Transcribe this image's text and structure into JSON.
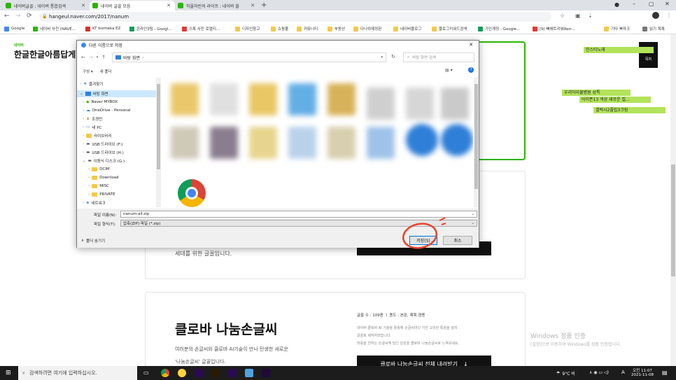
{
  "browser": {
    "tabs": [
      {
        "label": "네이버글꼴 : 네이버 통합검색"
      },
      {
        "label": "네이버 글꼴 모음"
      },
      {
        "label": "하울하린의 라이프 : 네이버 블"
      }
    ],
    "url": "hangeul.naver.com/2017/nanum",
    "bookmarks": [
      "Google",
      "네이버 사전 (NAVE...",
      "KT bizmeka EZ",
      "온라인3팀 - Googl...",
      "스톡 사진 로열티...",
      "디자인참고",
      "쇼핑몰",
      "커뮤니티",
      "부동산",
      "다나와제정된",
      "네이버블로그",
      "블로그키워드검색",
      "가인계정 - Google...",
      "(9) 뼤에트리뷰Rerr...",
      "기타 북마크",
      "읽기 목록"
    ]
  },
  "site": {
    "logo_small": "네이버",
    "logo_main": "한글한글아름답게",
    "menu_label": "목차",
    "card2_desc": "세대를 위한 글꼴입니다.",
    "card3": {
      "title": "클로바 나눔손글씨",
      "desc_line1": "여러분의 손글씨와 클로바 AI기술이 만나 탄생한 새로운",
      "desc_line2": "'나눔손글씨' 글꼴입니다.",
      "meta": "글꼴 수 : 109종 ㅣ 용도 : 본문, 제목 겸용",
      "info_line1": "네이버 클로바 AI 기술을 활용해 손글씨마다 가진 고유한 특징을 살려",
      "info_line2": "글꼴로 제작하였습니다.",
      "info_line3": "마음을 전하는 손글씨에 담긴 감성을 클로바 나눔손글씨로 느껴보세요.",
      "download_label": "클로바 나눔손글씨 전체 내려받기"
    },
    "sticky_notes": [
      "인스타노래",
      "우리아이물병원 성특",
      "아이폰13 색상 새로운 컬...",
      "갤럭시2플립3크림"
    ],
    "watermark_line1": "Windows 정품 인증",
    "watermark_line2": "[설정]으로 이동하여 Windows를 정품 인증합니다."
  },
  "dialog": {
    "title": "다른 이름으로 저장",
    "path": "바탕 화면",
    "search_placeholder": "바탕 화면 검색",
    "organize_label": "구성 ▾",
    "new_folder_label": "새 폴더",
    "tree": [
      "즐겨찾기",
      "바탕 화면",
      "Naver MYBOX",
      "OneDrive - Personal",
      "조경민",
      "내 PC",
      "라이브러리",
      "USB 드라이브 (F:)",
      "USB 드라이브 (H:)",
      "이동식 디스크 (G:)",
      "DCIM",
      "Download",
      "MISC",
      "PRIVATE",
      "네트워크"
    ],
    "filename_label": "파일 이름(N):",
    "filename_value": "nanum-all.zip",
    "filetype_label": "파일 형식(T):",
    "filetype_value": "압축(ZIP) 파일 (*.zip)",
    "hide_folders_label": "폴더 숨기기",
    "save_label": "저장(S)",
    "cancel_label": "취소"
  },
  "taskbar": {
    "search_placeholder": "검색하려면 여기에 입력하십시오.",
    "weather": "9°C 비",
    "ime": "A",
    "time": "오전 11:07",
    "date": "2021-11-08"
  },
  "colors": {
    "accent_green": "#2db400",
    "highlight": "#b2e35a",
    "annotation_red": "#e8442e"
  }
}
